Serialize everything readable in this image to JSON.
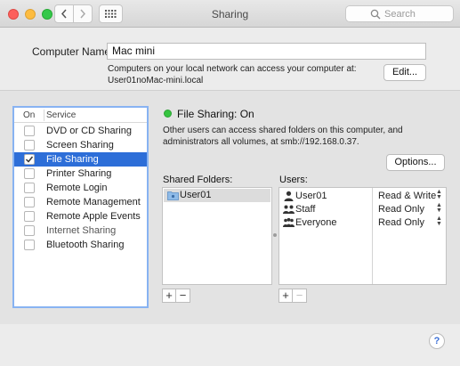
{
  "window": {
    "title": "Sharing",
    "search_placeholder": "Search"
  },
  "top": {
    "computer_name_label": "Computer Name:",
    "computer_name_value": "Mac mini",
    "access_note_line1": "Computers on your local network can access your computer at:",
    "access_note_line2": "User01noMac-mini.local",
    "edit_label": "Edit..."
  },
  "services": {
    "header_on": "On",
    "header_service": "Service",
    "items": [
      {
        "label": "DVD or CD Sharing",
        "checked": false,
        "selected": false
      },
      {
        "label": "Screen Sharing",
        "checked": false,
        "selected": false
      },
      {
        "label": "File Sharing",
        "checked": true,
        "selected": true
      },
      {
        "label": "Printer Sharing",
        "checked": false,
        "selected": false
      },
      {
        "label": "Remote Login",
        "checked": false,
        "selected": false
      },
      {
        "label": "Remote Management",
        "checked": false,
        "selected": false
      },
      {
        "label": "Remote Apple Events",
        "checked": false,
        "selected": false
      },
      {
        "label": "Internet Sharing",
        "checked": false,
        "selected": false,
        "dimmed": true
      },
      {
        "label": "Bluetooth Sharing",
        "checked": false,
        "selected": false
      }
    ]
  },
  "file_sharing": {
    "status": "File Sharing: On",
    "status_color": "#35c43f",
    "description": "Other users can access shared folders on this computer, and administrators all volumes, at smb://192.168.0.37.",
    "options_label": "Options...",
    "shared_folders_label": "Shared Folders:",
    "users_label": "Users:",
    "shared_folders": [
      "User01"
    ],
    "users": [
      {
        "name": "User01",
        "permission": "Read & Write",
        "icon": "single-user-icon"
      },
      {
        "name": "Staff",
        "permission": "Read Only",
        "icon": "group-icon"
      },
      {
        "name": "Everyone",
        "permission": "Read Only",
        "icon": "group-icon"
      }
    ],
    "add_label": "+",
    "remove_label": "−"
  },
  "help_label": "?",
  "accent_color": "#2d6ed8"
}
